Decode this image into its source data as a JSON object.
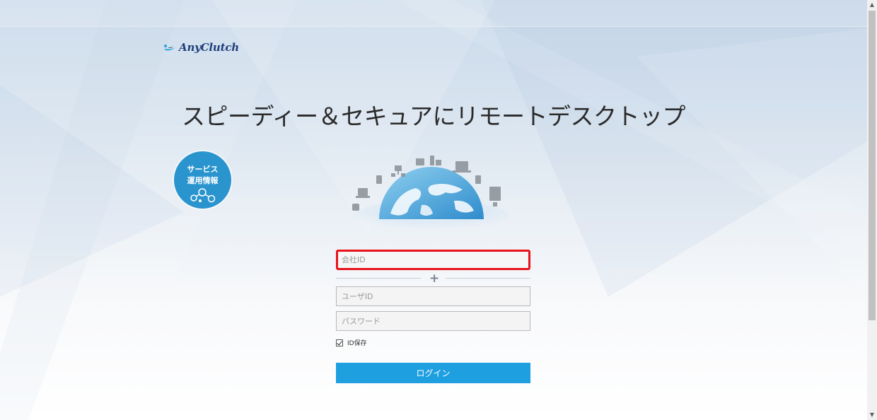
{
  "logo": {
    "text": "AnyClutch"
  },
  "headline": "スピーディー＆セキュアにリモートデスクトップ",
  "service_badge": {
    "line1": "サービス",
    "line2": "運用情報"
  },
  "form": {
    "company_id_placeholder": "会社ID",
    "user_id_placeholder": "ユーザID",
    "password_placeholder": "パスワード",
    "remember_label": "ID保存",
    "remember_checked": true,
    "login_label": "ログイン"
  },
  "scrollbar": {
    "up_arrow": "▲",
    "down_arrow": "▼"
  },
  "colors": {
    "accent": "#1e9fe0",
    "badge": "#2a94cf",
    "highlight_border": "#e8131a",
    "logo": "#1e3f7a"
  }
}
